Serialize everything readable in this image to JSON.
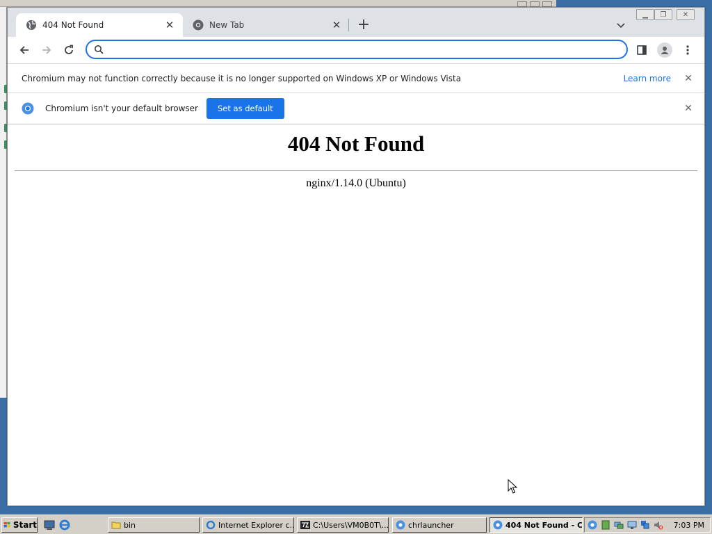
{
  "browser": {
    "tabs": [
      {
        "title": "404 Not Found",
        "active": true
      },
      {
        "title": "New Tab",
        "active": false
      }
    ],
    "omnibox": {
      "value": "",
      "placeholder": ""
    },
    "infobars": {
      "unsupported": {
        "message": "Chromium may not function correctly because it is no longer supported on Windows XP or Windows Vista",
        "link": "Learn more"
      },
      "default_browser": {
        "message": "Chromium isn't your default browser",
        "button": "Set as default"
      }
    }
  },
  "page": {
    "heading": "404 Not Found",
    "server": "nginx/1.14.0 (Ubuntu)"
  },
  "taskbar": {
    "start_label": "Start",
    "tasks": [
      {
        "label": "bin",
        "icon": "folder-icon",
        "active": false
      },
      {
        "label": "Internet Explorer c...",
        "icon": "internet-explorer-icon",
        "active": false
      },
      {
        "label": "C:\\Users\\VM0B0T\\...",
        "icon": "7zip-icon",
        "active": false
      },
      {
        "label": "chrlauncher",
        "icon": "chromium-icon",
        "active": false
      },
      {
        "label": "404 Not Found - C...",
        "icon": "chromium-icon",
        "active": true
      }
    ],
    "clock": "7:03 PM"
  },
  "colors": {
    "desktop": "#3a6ea5",
    "accent": "#1a73e8",
    "tabstrip": "#dee1e6",
    "taskbar": "#d4d0c8"
  }
}
